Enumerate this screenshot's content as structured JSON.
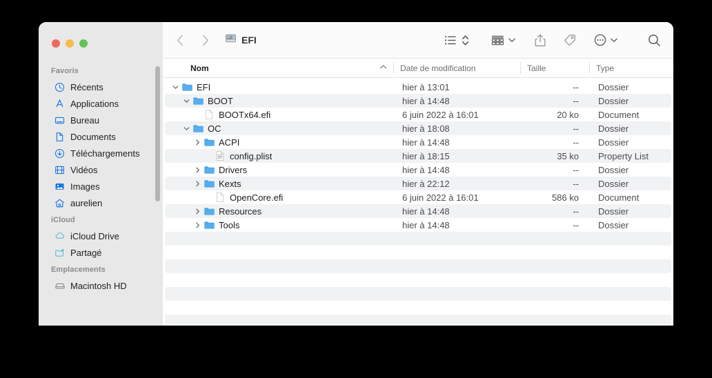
{
  "window": {
    "title": "EFI",
    "title_icon": "disk-drive-icon",
    "traffic_lights": [
      {
        "name": "close",
        "color": "#ec6a5e"
      },
      {
        "name": "minimize",
        "color": "#f4bd4f"
      },
      {
        "name": "maximize",
        "color": "#61c454"
      }
    ]
  },
  "toolbar": {
    "back": "back-chevron-icon",
    "forward": "forward-chevron-icon",
    "view_list": "list-view-icon",
    "view_sort": "sort-updown-icon",
    "group_by": "group-grid-icon",
    "group_chevron": "chevron-down-icon",
    "share": "share-icon",
    "tag": "tag-icon",
    "more": "ellipsis-circle-icon",
    "more_chevron": "chevron-down-icon",
    "search": "search-icon"
  },
  "sidebar": {
    "sections": [
      {
        "title": "Favoris",
        "items": [
          {
            "label": "Récents",
            "icon": "clock-icon"
          },
          {
            "label": "Applications",
            "icon": "applications-icon"
          },
          {
            "label": "Bureau",
            "icon": "desktop-icon"
          },
          {
            "label": "Documents",
            "icon": "document-icon"
          },
          {
            "label": "Téléchargements",
            "icon": "downloads-icon"
          },
          {
            "label": "Vidéos",
            "icon": "movie-icon"
          },
          {
            "label": "Images",
            "icon": "photo-icon"
          },
          {
            "label": "aurelien",
            "icon": "home-icon"
          }
        ]
      },
      {
        "title": "iCloud",
        "items": [
          {
            "label": "iCloud Drive",
            "icon": "cloud-icon"
          },
          {
            "label": "Partagé",
            "icon": "shared-folder-icon"
          }
        ]
      },
      {
        "title": "Emplacements",
        "items": [
          {
            "label": "Macintosh HD",
            "icon": "harddisk-icon"
          }
        ]
      }
    ]
  },
  "columns": {
    "name": "Nom",
    "date": "Date de modification",
    "size": "Taille",
    "type": "Type",
    "sort_arrow": "⌃",
    "sorted_by": "Nom",
    "sort_direction": "ascending"
  },
  "files": [
    {
      "name": "EFI",
      "indent": 0,
      "kind": "folder",
      "disclosure": "open",
      "date": "hier à 13:01",
      "size": "--",
      "type": "Dossier"
    },
    {
      "name": "BOOT",
      "indent": 1,
      "kind": "folder",
      "disclosure": "open",
      "date": "hier à 14:48",
      "size": "--",
      "type": "Dossier"
    },
    {
      "name": "BOOTx64.efi",
      "indent": 2,
      "kind": "document",
      "disclosure": "none",
      "date": "6 juin 2022 à 16:01",
      "size": "20 ko",
      "type": "Document"
    },
    {
      "name": "OC",
      "indent": 1,
      "kind": "folder",
      "disclosure": "open",
      "date": "hier à 18:08",
      "size": "--",
      "type": "Dossier"
    },
    {
      "name": "ACPI",
      "indent": 2,
      "kind": "folder",
      "disclosure": "closed",
      "date": "hier à 14:48",
      "size": "--",
      "type": "Dossier"
    },
    {
      "name": "config.plist",
      "indent": 3,
      "kind": "plist",
      "disclosure": "none",
      "date": "hier à 18:15",
      "size": "35 ko",
      "type": "Property List"
    },
    {
      "name": "Drivers",
      "indent": 2,
      "kind": "folder",
      "disclosure": "closed",
      "date": "hier à 14:48",
      "size": "--",
      "type": "Dossier"
    },
    {
      "name": "Kexts",
      "indent": 2,
      "kind": "folder",
      "disclosure": "closed",
      "date": "hier à 22:12",
      "size": "--",
      "type": "Dossier"
    },
    {
      "name": "OpenCore.efi",
      "indent": 3,
      "kind": "document",
      "disclosure": "none",
      "date": "6 juin 2022 à 16:01",
      "size": "586 ko",
      "type": "Document"
    },
    {
      "name": "Resources",
      "indent": 2,
      "kind": "folder",
      "disclosure": "closed",
      "date": "hier à 14:48",
      "size": "--",
      "type": "Dossier"
    },
    {
      "name": "Tools",
      "indent": 2,
      "kind": "folder",
      "disclosure": "closed",
      "date": "hier à 14:48",
      "size": "--",
      "type": "Dossier"
    }
  ],
  "empty_row_count": 9,
  "colors": {
    "folder_blue": "#4aa3e8",
    "sidebar_icon_blue": "#1577e8",
    "icloud_teal": "#55bfca",
    "stripe": "#f1f2f3",
    "sidebar_bg": "#e9e8e9"
  }
}
